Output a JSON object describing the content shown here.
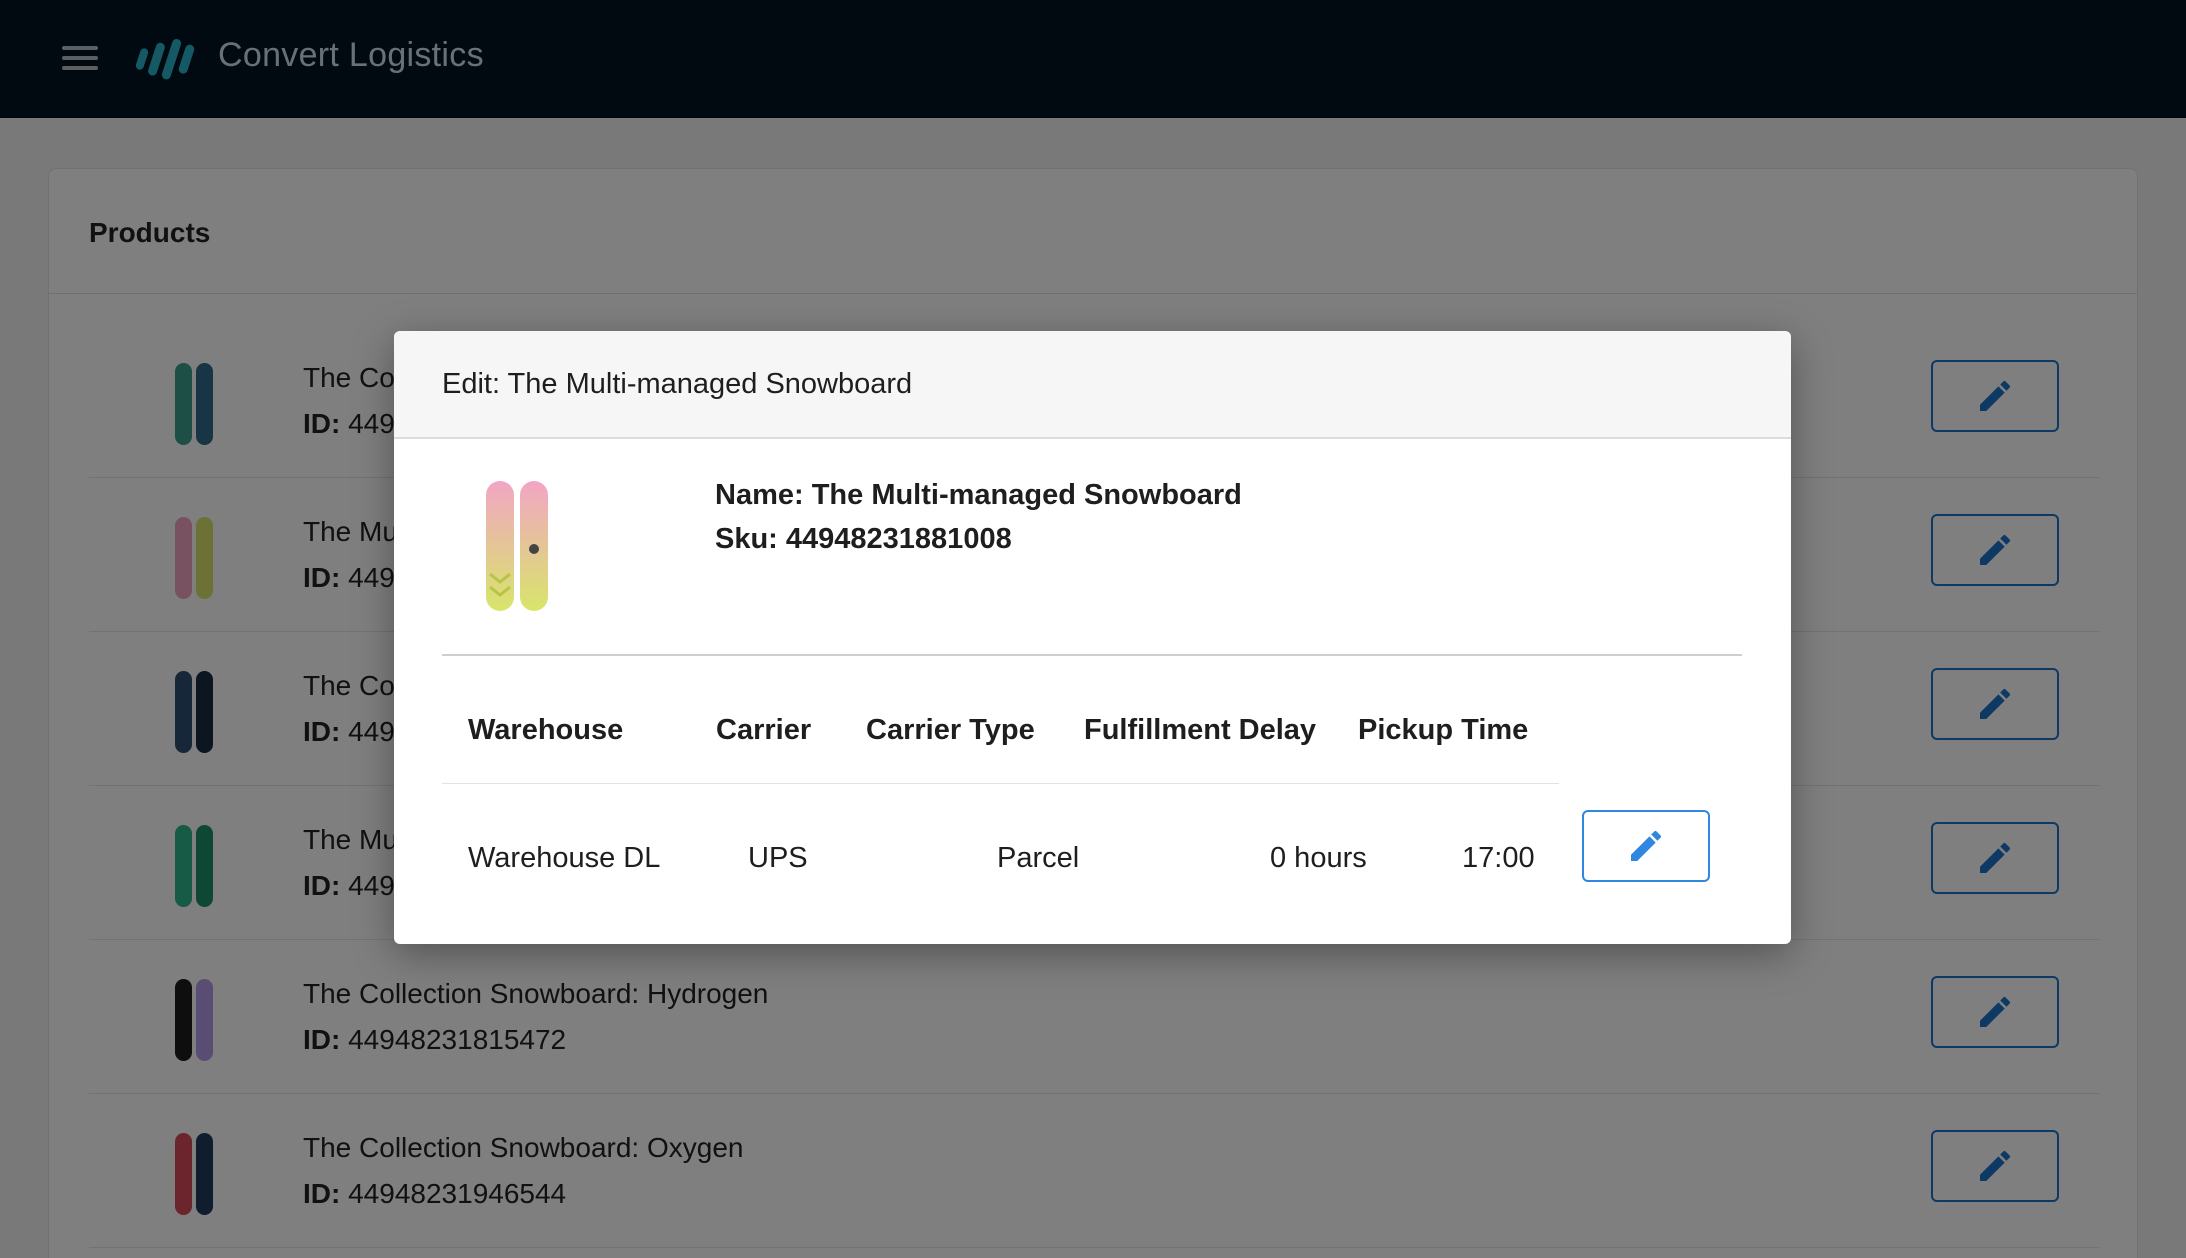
{
  "app": {
    "title": "Convert Logistics",
    "menu_icon": "hamburger-icon",
    "logo_icon": "bars-logo-icon"
  },
  "colors": {
    "topbar": "#021520",
    "accent": "#1a73c8",
    "overlay": "rgba(0,0,0,0.5)"
  },
  "products_card": {
    "title": "Products",
    "id_label": "ID:",
    "rows": [
      {
        "name": "The Co",
        "id": "449",
        "colors": [
          "#3a9e8c",
          "#2f6a88"
        ]
      },
      {
        "name": "The Mu",
        "id": "449",
        "colors": [
          "#f2a5c4",
          "#d8e56a"
        ]
      },
      {
        "name": "The Co",
        "id": "449",
        "colors": [
          "#2d4e73",
          "#1a2a40"
        ]
      },
      {
        "name": "The Mu",
        "id": "449",
        "colors": [
          "#2fb58a",
          "#1f8f6a"
        ]
      },
      {
        "name": "The Collection Snowboard: Hydrogen",
        "id": "44948231815472",
        "colors": [
          "#1c1c1c",
          "#b59be6"
        ]
      },
      {
        "name": "The Collection Snowboard: Oxygen",
        "id": "44948231946544",
        "colors": [
          "#d94b5a",
          "#1e3a5e"
        ]
      }
    ]
  },
  "modal": {
    "title": "Edit: The Multi-managed Snowboard",
    "name_line": "Name: The Multi-managed Snowboard",
    "sku_line": "Sku: 44948231881008",
    "thumb_colors": [
      "#f2a5c4",
      "#d8e56a"
    ],
    "columns": [
      "Warehouse",
      "Carrier",
      "Carrier Type",
      "Fulfillment Delay",
      "Pickup Time"
    ],
    "rows": [
      {
        "warehouse": "Warehouse DL",
        "carrier": "UPS",
        "carrier_type": "Parcel",
        "fulfillment_delay": "0 hours",
        "pickup_time": "17:00"
      }
    ]
  }
}
